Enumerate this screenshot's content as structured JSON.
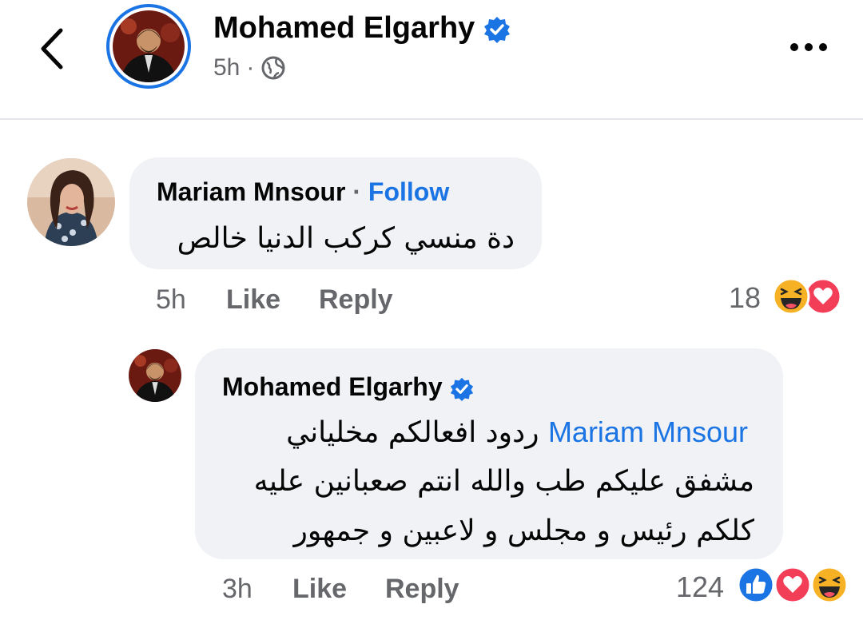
{
  "header": {
    "author_name": "Mohamed Elgarhy",
    "time": "5h",
    "separator": "·",
    "icons": {
      "back": "chevron-left-icon",
      "verified": "verified-badge-icon",
      "privacy": "globe-icon",
      "more": "more-dots-icon"
    }
  },
  "comments": [
    {
      "author": "Mariam Mnsour",
      "separator": "·",
      "follow_label": "Follow",
      "text_lines": [
        "دة منسي كركب الدنيا خالص"
      ],
      "time": "5h",
      "like_label": "Like",
      "reply_label": "Reply",
      "reaction_count": "18",
      "reactions": [
        "haha",
        "love"
      ]
    },
    {
      "author": "Mohamed Elgarhy",
      "verified": true,
      "mention": "Mariam Mnsour",
      "text_lines": [
        "ردود افعالكم مخلياني",
        "مشفق عليكم طب والله انتم صعبانين عليه",
        "كلكم  رئيس و مجلس و لاعبين و جمهور"
      ],
      "time": "3h",
      "like_label": "Like",
      "reply_label": "Reply",
      "reaction_count": "124",
      "reactions": [
        "like",
        "love",
        "haha"
      ]
    }
  ],
  "colors": {
    "accent": "#1b74e4",
    "bubble": "#f0f2f5",
    "secondary_text": "#65676b",
    "love": "#f33e58",
    "haha": "#f7b125"
  }
}
